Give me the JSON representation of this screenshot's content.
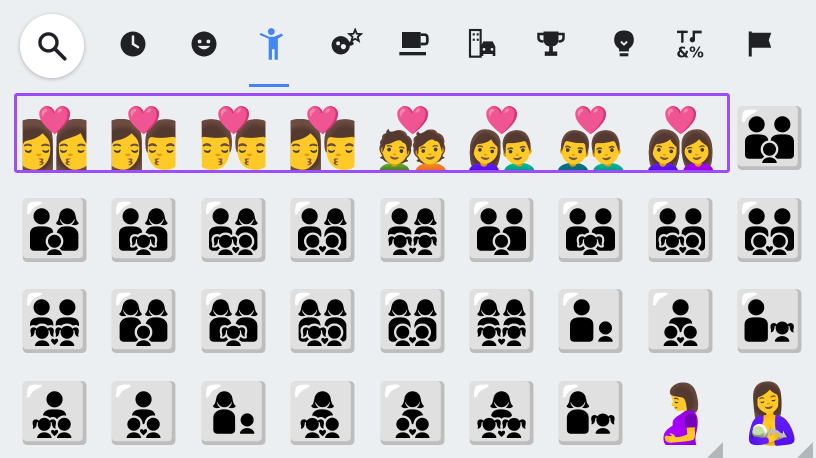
{
  "tabs": [
    {
      "name": "search-icon",
      "label": ""
    },
    {
      "name": "recent-icon",
      "label": ""
    },
    {
      "name": "smileys-icon",
      "label": ""
    },
    {
      "name": "people-icon",
      "label": "",
      "active": true
    },
    {
      "name": "animals-nature-icon",
      "label": ""
    },
    {
      "name": "food-drink-icon",
      "label": ""
    },
    {
      "name": "travel-places-icon",
      "label": ""
    },
    {
      "name": "activities-icon",
      "label": ""
    },
    {
      "name": "objects-icon",
      "label": ""
    },
    {
      "name": "symbols-icon",
      "label": ""
    },
    {
      "name": "flags-icon",
      "label": ""
    }
  ],
  "colors": {
    "background": "#eceff1",
    "accent": "#4285f4",
    "highlight_border": "#9c4dff",
    "icon": "#202124"
  },
  "emoji_rows": [
    [
      "👩‍❤️‍💋‍👩",
      "👩‍❤️‍💋‍👨",
      "👨‍❤️‍💋‍👨",
      "👩‍❤️‍💋‍👨",
      "💑",
      "👩‍❤️‍👨",
      "👨‍❤️‍👨",
      "👩‍❤️‍👩",
      "👪"
    ],
    [
      "👨‍👩‍👦",
      "👨‍👩‍👧",
      "👨‍👩‍👧‍👦",
      "👨‍👩‍👦‍👦",
      "👨‍👩‍👧‍👧",
      "👨‍👨‍👦",
      "👨‍👨‍👧",
      "👨‍👨‍👧‍👦",
      "👨‍👨‍👦‍👦"
    ],
    [
      "👨‍👨‍👧‍👧",
      "👩‍👩‍👦",
      "👩‍👩‍👧",
      "👩‍👩‍👧‍👦",
      "👩‍👩‍👦‍👦",
      "👩‍👩‍👧‍👧",
      "👨‍👦",
      "👨‍👦‍👦",
      "👨‍👧"
    ],
    [
      "👨‍👧‍👦",
      "👨‍👦‍👦",
      "👩‍👦",
      "👩‍👧‍👦",
      "👩‍👦‍👦",
      "👩‍👧‍👧",
      "👩‍👧",
      "🤰",
      "🤱"
    ]
  ]
}
